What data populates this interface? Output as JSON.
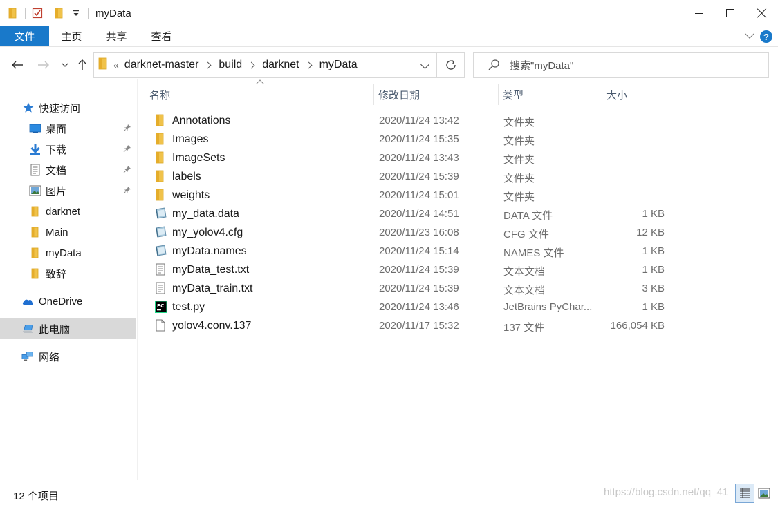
{
  "titlebar": {
    "title": "myData",
    "icons": [
      "folder-icon",
      "properties-check-icon",
      "new-folder-icon",
      "customize-quick-access-icon"
    ]
  },
  "ribbon": {
    "file_tab": "文件",
    "tabs": [
      "主页",
      "共享",
      "查看"
    ],
    "accent": "#1979ca"
  },
  "address": {
    "overflow": "«",
    "crumbs": [
      "darknet-master",
      "build",
      "darknet",
      "myData"
    ]
  },
  "search": {
    "placeholder": "搜索\"myData\""
  },
  "sidebar": {
    "items": [
      {
        "label": "快速访问",
        "icon": "star-icon"
      },
      {
        "label": "桌面",
        "icon": "desktop-icon",
        "pinned": true
      },
      {
        "label": "下载",
        "icon": "download-icon",
        "pinned": true
      },
      {
        "label": "文档",
        "icon": "document-icon",
        "pinned": true
      },
      {
        "label": "图片",
        "icon": "picture-icon",
        "pinned": true
      },
      {
        "label": "darknet",
        "icon": "folder-icon"
      },
      {
        "label": "Main",
        "icon": "folder-icon"
      },
      {
        "label": "myData",
        "icon": "folder-icon"
      },
      {
        "label": "致辞",
        "icon": "folder-icon"
      },
      {
        "label": "OneDrive",
        "icon": "cloud-icon"
      },
      {
        "label": "此电脑",
        "icon": "computer-icon",
        "selected": true
      },
      {
        "label": "网络",
        "icon": "network-icon"
      }
    ]
  },
  "columns": {
    "name": "名称",
    "date": "修改日期",
    "type": "类型",
    "size": "大小"
  },
  "files": [
    {
      "name": "Annotations",
      "date": "2020/11/24 13:42",
      "type": "文件夹",
      "size": "",
      "icon": "folder-icon"
    },
    {
      "name": "Images",
      "date": "2020/11/24 15:35",
      "type": "文件夹",
      "size": "",
      "icon": "folder-icon"
    },
    {
      "name": "ImageSets",
      "date": "2020/11/24 13:43",
      "type": "文件夹",
      "size": "",
      "icon": "folder-icon"
    },
    {
      "name": "labels",
      "date": "2020/11/24 15:39",
      "type": "文件夹",
      "size": "",
      "icon": "folder-icon"
    },
    {
      "name": "weights",
      "date": "2020/11/24 15:01",
      "type": "文件夹",
      "size": "",
      "icon": "folder-icon"
    },
    {
      "name": "my_data.data",
      "date": "2020/11/24 14:51",
      "type": "DATA 文件",
      "size": "1 KB",
      "icon": "generic-app-file-icon"
    },
    {
      "name": "my_yolov4.cfg",
      "date": "2020/11/23 16:08",
      "type": "CFG 文件",
      "size": "12 KB",
      "icon": "generic-app-file-icon"
    },
    {
      "name": "myData.names",
      "date": "2020/11/24 15:14",
      "type": "NAMES 文件",
      "size": "1 KB",
      "icon": "generic-app-file-icon"
    },
    {
      "name": "myData_test.txt",
      "date": "2020/11/24 15:39",
      "type": "文本文档",
      "size": "1 KB",
      "icon": "text-file-icon"
    },
    {
      "name": "myData_train.txt",
      "date": "2020/11/24 15:39",
      "type": "文本文档",
      "size": "3 KB",
      "icon": "text-file-icon"
    },
    {
      "name": "test.py",
      "date": "2020/11/24 13:46",
      "type": "JetBrains PyChar...",
      "size": "1 KB",
      "icon": "pycharm-icon"
    },
    {
      "name": "yolov4.conv.137",
      "date": "2020/11/17 15:32",
      "type": "137 文件",
      "size": "166,054 KB",
      "icon": "blank-file-icon"
    }
  ],
  "status": {
    "count": "12 个项目",
    "watermark": "https://blog.csdn.net/qq_41"
  }
}
